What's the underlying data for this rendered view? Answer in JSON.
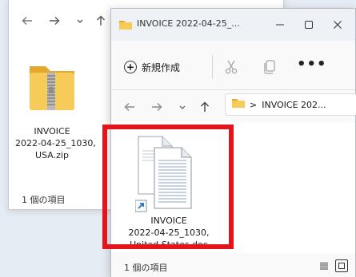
{
  "back_window": {
    "file": {
      "name_lines": [
        "INVOICE",
        "2022-04-25_1030,",
        "USA.zip"
      ],
      "icon": "zip-folder-icon"
    },
    "status": "1 個の項目"
  },
  "front_window": {
    "title": "INVOICE 2022-04-25_...",
    "toolbar": {
      "new_label": "新規作成",
      "icons": [
        "cut-icon",
        "copy-icon",
        "more-icon"
      ],
      "more_label": "•••"
    },
    "address": {
      "separator": ">",
      "path_label": "INVOICE 202..."
    },
    "file": {
      "name_lines": [
        "INVOICE",
        "2022-04-25_1030,",
        "United States.doc"
      ],
      "icon": "shortcut-document-icon"
    },
    "status": "1 個の項目"
  },
  "colors": {
    "highlight": "#e3141b",
    "folder": "#f3c64a",
    "shortcut_arrow": "#1f6fd6"
  }
}
